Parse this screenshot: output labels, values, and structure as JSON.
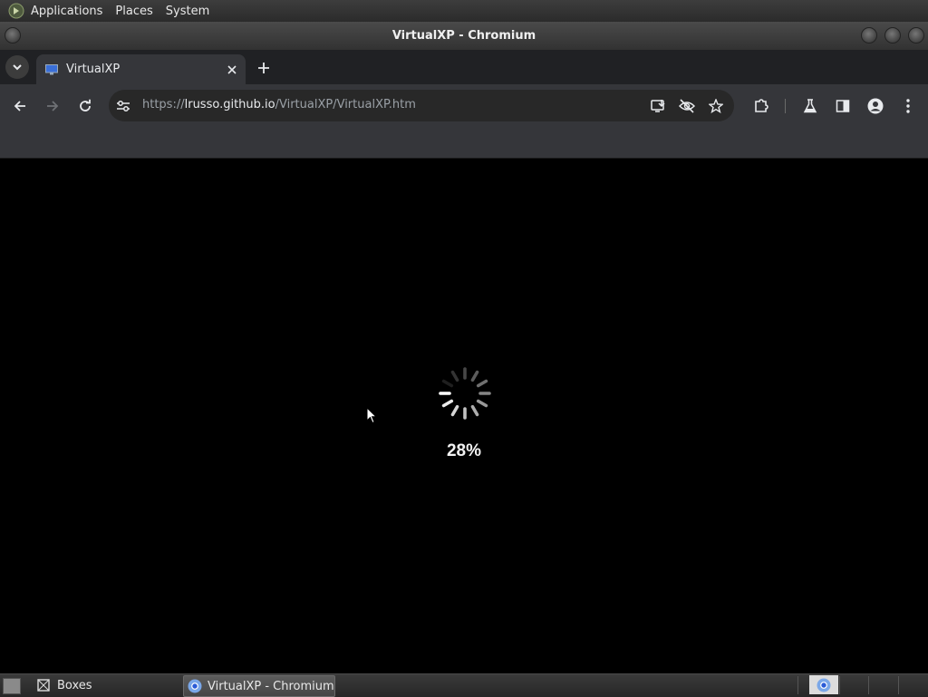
{
  "top_panel": {
    "menus": [
      "Applications",
      "Places",
      "System"
    ]
  },
  "window": {
    "title": "VirtualXP - Chromium"
  },
  "browser": {
    "tab": {
      "title": "VirtualXP"
    },
    "omnibox": {
      "scheme": "https://",
      "host": "lrusso.github.io",
      "path": "/VirtualXP/VirtualXP.htm"
    }
  },
  "page": {
    "progress_text": "28%",
    "progress_value": 0.28
  },
  "taskbar": {
    "tasks": [
      {
        "label": "Boxes",
        "active": false
      },
      {
        "label": "VirtualXP - Chromium",
        "active": true
      }
    ]
  },
  "icons": {
    "menu_logo": "gnome-foot-icon",
    "tab_search": "chevron-down-icon",
    "tab_favicon": "monitor-icon",
    "tab_close": "close-icon",
    "new_tab": "plus-icon",
    "back": "arrow-left-icon",
    "forward": "arrow-right-icon",
    "reload": "reload-icon",
    "site_info": "tune-icon",
    "install": "install-app-icon",
    "tracking": "eye-off-icon",
    "bookmark": "star-icon",
    "extensions": "puzzle-icon",
    "labs": "flask-icon",
    "side_panel": "side-panel-icon",
    "profile": "profile-icon",
    "menu": "kebab-icon"
  }
}
